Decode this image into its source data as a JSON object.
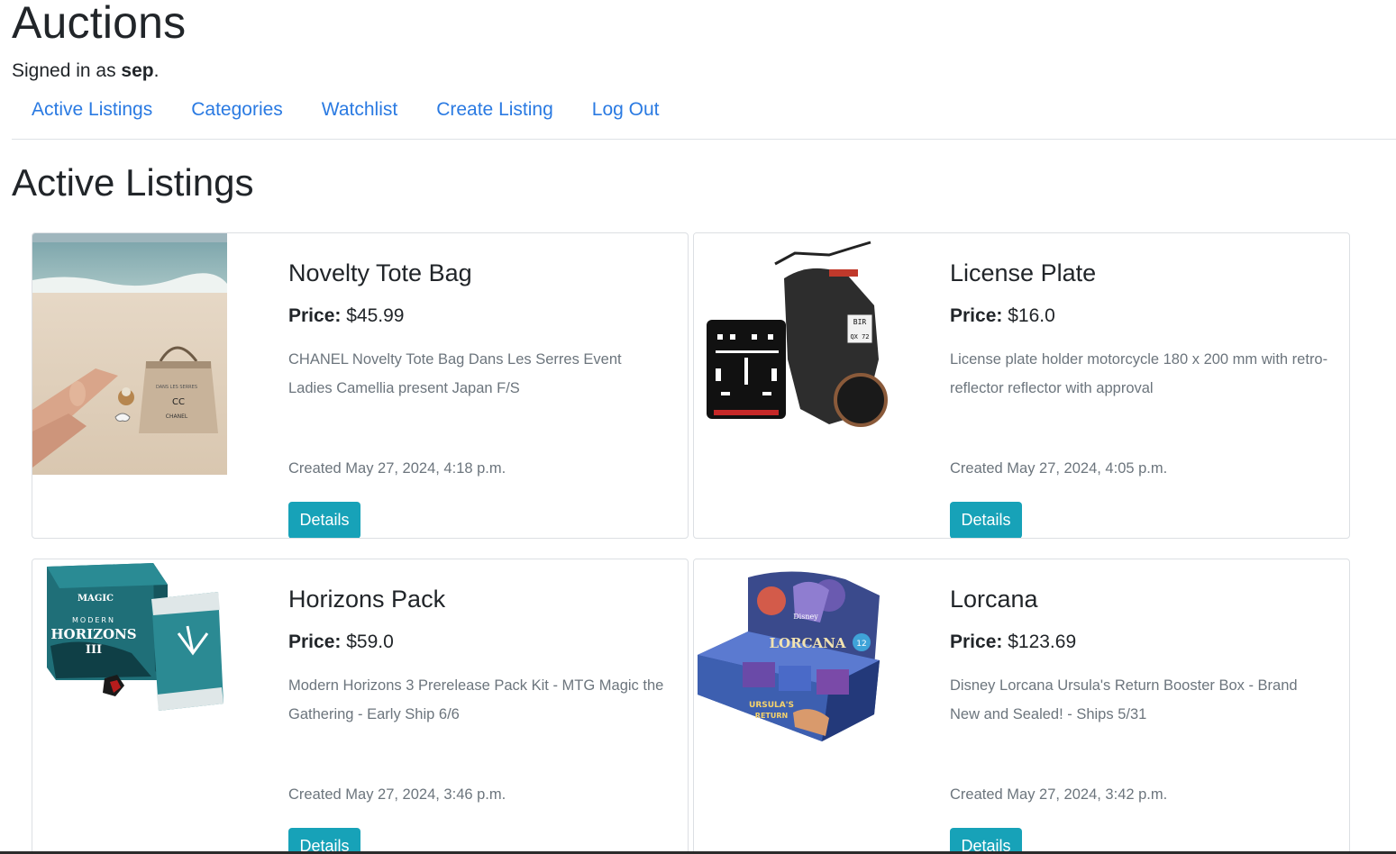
{
  "header": {
    "title": "Auctions",
    "signed_in_prefix": "Signed in as ",
    "username": "sep",
    "signed_in_suffix": "."
  },
  "nav": {
    "items": [
      {
        "label": "Active Listings"
      },
      {
        "label": "Categories"
      },
      {
        "label": "Watchlist"
      },
      {
        "label": "Create Listing"
      },
      {
        "label": "Log Out"
      }
    ]
  },
  "main": {
    "section_title": "Active Listings",
    "listings": [
      {
        "title": "Novelty Tote Bag",
        "price_label": "Price:",
        "price": "$45.99",
        "description": "CHANEL Novelty Tote Bag Dans Les Serres Event Ladies Camellia present Japan F/S",
        "created": "Created May 27, 2024, 4:18 p.m.",
        "button": "Details",
        "image_icon": "beach-tote-bag-photo"
      },
      {
        "title": "License Plate",
        "price_label": "Price:",
        "price": "$16.0",
        "description": "License plate holder motorcycle 180 x 200 mm with retro-reflector reflector with approval",
        "created": "Created May 27, 2024, 4:05 p.m.",
        "button": "Details",
        "image_icon": "motorcycle-plate-holder-photo"
      },
      {
        "title": "Horizons Pack",
        "price_label": "Price:",
        "price": "$59.0",
        "description": "Modern Horizons 3 Prerelease Pack Kit - MTG Magic the Gathering - Early Ship 6/6",
        "created": "Created May 27, 2024, 3:46 p.m.",
        "button": "Details",
        "image_icon": "mtg-prerelease-pack-photo"
      },
      {
        "title": "Lorcana",
        "price_label": "Price:",
        "price": "$123.69",
        "description": "Disney Lorcana Ursula's Return Booster Box - Brand New and Sealed! - Ships 5/31",
        "created": "Created May 27, 2024, 3:42 p.m.",
        "button": "Details",
        "image_icon": "lorcana-booster-box-photo"
      }
    ]
  },
  "image_text": {
    "chanel_logo": "CC",
    "chanel_brand": "CHANEL",
    "tote_print": "DANS LES SERRES",
    "plate_text_1": "BIR",
    "plate_text_2": "QX 72",
    "magic_logo": "MAGIC",
    "mh_modern": "MODERN",
    "mh_horizons": "HORIZONS",
    "mh_three": "III",
    "lorcana_brand": "Disney",
    "lorcana_title": "LORCANA",
    "lorcana_count": "12",
    "lorcana_ursula": "URSULA'S",
    "lorcana_return": "RETURN"
  },
  "colors": {
    "link": "#2a7ae2",
    "button": "#17a2b8",
    "muted_text": "#6c757d",
    "border": "#dcdfe3"
  }
}
